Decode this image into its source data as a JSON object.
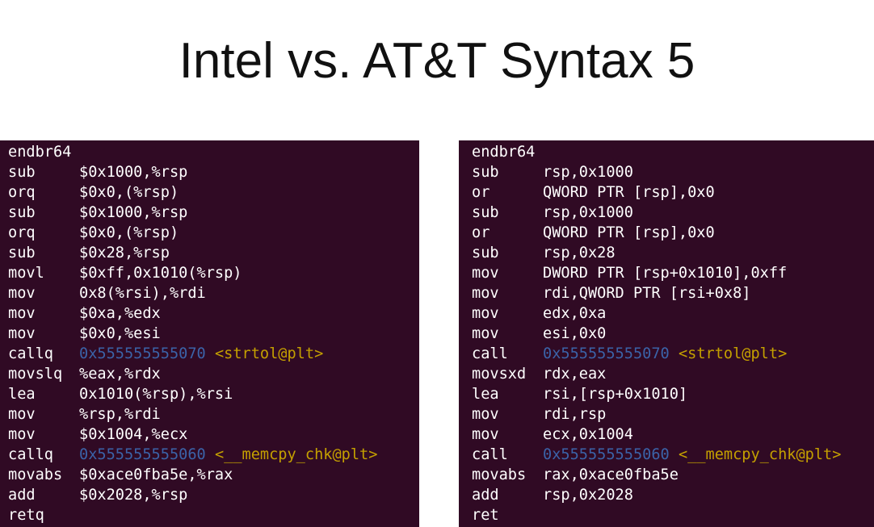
{
  "title": "Intel vs. AT&T Syntax 5",
  "colors": {
    "background": "#ffffff",
    "terminal_bg": "#300a24",
    "text": "#ffffff",
    "address": "#3b63a8",
    "symbol": "#c4a000"
  },
  "att": {
    "lines": [
      {
        "mn": "endbr64",
        "op": ""
      },
      {
        "mn": "sub",
        "op": "$0x1000,%rsp"
      },
      {
        "mn": "orq",
        "op": "$0x0,(%rsp)"
      },
      {
        "mn": "sub",
        "op": "$0x1000,%rsp"
      },
      {
        "mn": "orq",
        "op": "$0x0,(%rsp)"
      },
      {
        "mn": "sub",
        "op": "$0x28,%rsp"
      },
      {
        "mn": "movl",
        "op": "$0xff,0x1010(%rsp)"
      },
      {
        "mn": "mov",
        "op": "0x8(%rsi),%rdi"
      },
      {
        "mn": "mov",
        "op": "$0xa,%edx"
      },
      {
        "mn": "mov",
        "op": "$0x0,%esi"
      },
      {
        "mn": "callq",
        "op": "",
        "addr": "0x555555555070",
        "sym": "<strtol@plt>"
      },
      {
        "mn": "movslq",
        "op": "%eax,%rdx"
      },
      {
        "mn": "lea",
        "op": "0x1010(%rsp),%rsi"
      },
      {
        "mn": "mov",
        "op": "%rsp,%rdi"
      },
      {
        "mn": "mov",
        "op": "$0x1004,%ecx"
      },
      {
        "mn": "callq",
        "op": "",
        "addr": "0x555555555060",
        "sym": "<__memcpy_chk@plt>"
      },
      {
        "mn": "movabs",
        "op": "$0xace0fba5e,%rax"
      },
      {
        "mn": "add",
        "op": "$0x2028,%rsp"
      },
      {
        "mn": "retq",
        "op": ""
      }
    ]
  },
  "intel": {
    "lines": [
      {
        "mn": "endbr64",
        "op": ""
      },
      {
        "mn": "sub",
        "op": "rsp,0x1000"
      },
      {
        "mn": "or",
        "op": "QWORD PTR [rsp],0x0"
      },
      {
        "mn": "sub",
        "op": "rsp,0x1000"
      },
      {
        "mn": "or",
        "op": "QWORD PTR [rsp],0x0"
      },
      {
        "mn": "sub",
        "op": "rsp,0x28"
      },
      {
        "mn": "mov",
        "op": "DWORD PTR [rsp+0x1010],0xff"
      },
      {
        "mn": "mov",
        "op": "rdi,QWORD PTR [rsi+0x8]"
      },
      {
        "mn": "mov",
        "op": "edx,0xa"
      },
      {
        "mn": "mov",
        "op": "esi,0x0"
      },
      {
        "mn": "call",
        "op": "",
        "addr": "0x555555555070",
        "sym": "<strtol@plt>"
      },
      {
        "mn": "movsxd",
        "op": "rdx,eax"
      },
      {
        "mn": "lea",
        "op": "rsi,[rsp+0x1010]"
      },
      {
        "mn": "mov",
        "op": "rdi,rsp"
      },
      {
        "mn": "mov",
        "op": "ecx,0x1004"
      },
      {
        "mn": "call",
        "op": "",
        "addr": "0x555555555060",
        "sym": "<__memcpy_chk@plt>"
      },
      {
        "mn": "movabs",
        "op": "rax,0xace0fba5e"
      },
      {
        "mn": "add",
        "op": "rsp,0x2028"
      },
      {
        "mn": "ret",
        "op": ""
      }
    ]
  }
}
